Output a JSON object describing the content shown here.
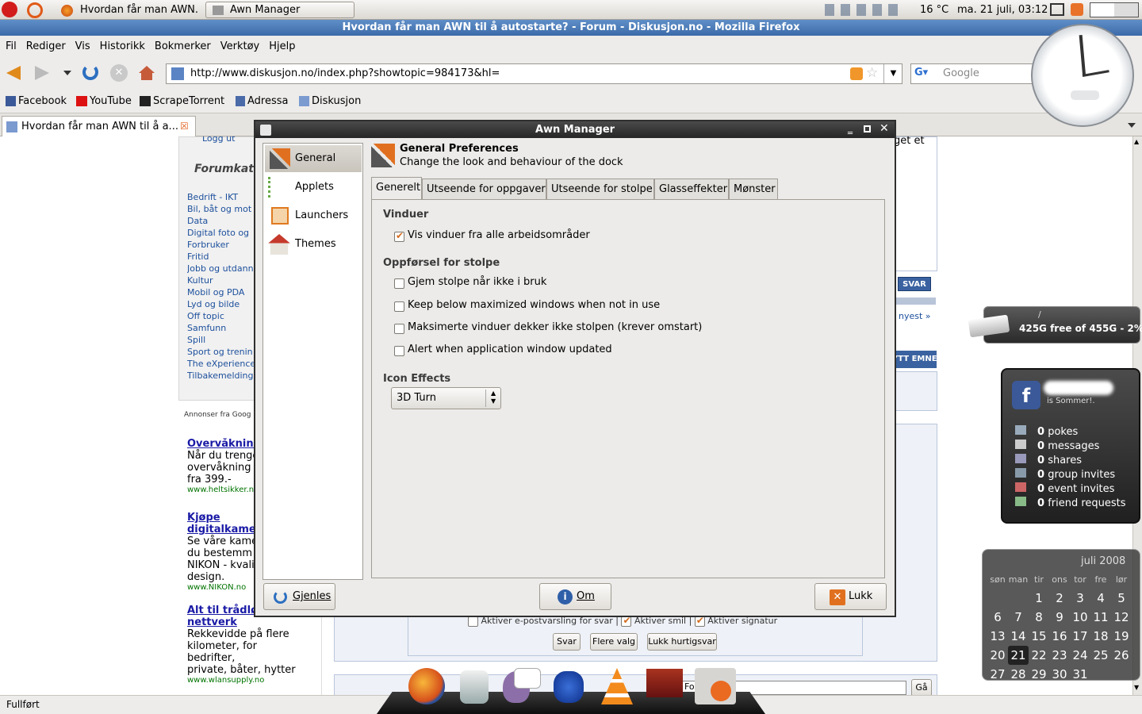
{
  "panel": {
    "tasks": [
      "Hvordan får man AWN...",
      "Awn Manager"
    ],
    "temp": "16 °C",
    "datetime": "ma. 21 juli, 03:12"
  },
  "firefox": {
    "title": "Hvordan får man AWN til å autostarte? - Forum - Diskusjon.no - Mozilla Firefox",
    "menu": [
      "Fil",
      "Rediger",
      "Vis",
      "Historikk",
      "Bokmerker",
      "Verktøy",
      "Hjelp"
    ],
    "url": "http://www.diskusjon.no/index.php?showtopic=984173&hl=",
    "search_placeholder": "Google",
    "bookmarks": [
      "Facebook",
      "YouTube",
      "ScrapeTorrent",
      "Adressa",
      "Diskusjon"
    ],
    "tab_label": "Hvordan får man AWN til å a...",
    "status": "Fullført"
  },
  "webpage": {
    "logout": "Logg ut",
    "forum_heading": "Forumkat",
    "categories": [
      "Bedrift - IKT",
      "Bil, båt og mot",
      "Data",
      "Digital foto og",
      "Forbruker",
      "Fritid",
      "Jobb og utdann",
      "Kultur",
      "Mobil og PDA",
      "Lyd og bilde",
      "Off topic",
      "Samfunn",
      "Spill",
      "Sport og trenin",
      "The eXperience",
      "Tilbakemelding"
    ],
    "ads_label": "Annonser fra Goog",
    "ads": [
      {
        "title": "Overvåkning",
        "lines": [
          "Når du trenge",
          "overvåkning",
          "fra 399.-"
        ],
        "url": "www.heltsikker.no"
      },
      {
        "title": "Kjøpe digitalkame",
        "lines": [
          "Se våre kame",
          "du bestemm",
          "NIKON - kvalit",
          "design."
        ],
        "url": "www.NIKON.no"
      },
      {
        "title": "Alt til trådløst nettverk",
        "lines": [
          "Rekkevidde på flere",
          "kilometer, for bedrifter,",
          "private, båter, hytter"
        ],
        "url": "www.wlansupply.no"
      }
    ],
    "right_snippet": "get et",
    "svar_btn": "SVAR",
    "nyest_link": "nyest »",
    "nytt_emne": "YTT EMNE",
    "options": [
      "Aktiver e-postvarsling for svar",
      "Aktiver smil",
      "Aktiver signatur"
    ],
    "buttons": [
      "Svar",
      "Flere valg",
      "Lukk hurtigsvar"
    ],
    "forum_select": "Foru",
    "go_btn": "Gå"
  },
  "dialog": {
    "title": "Awn Manager",
    "sidebar": [
      "General",
      "Applets",
      "Launchers",
      "Themes"
    ],
    "header_title": "General Preferences",
    "header_sub": "Change the look and behaviour of the dock",
    "tabs": [
      "Generelt",
      "Utseende for oppgaver",
      "Utseende for stolpe",
      "Glasseffekter",
      "Mønster"
    ],
    "section1": "Vinduer",
    "opt1": "Vis vinduer fra alle arbeidsområder",
    "section2": "Oppførsel for stolpe",
    "opt2": "Gjem stolpe når ikke i bruk",
    "opt3": "Keep below maximized windows when not in use",
    "opt4": "Maksimerte vinduer dekker ikke stolpen (krever omstart)",
    "opt5": "Alert when application window updated",
    "section3": "Icon Effects",
    "icon_effect": "3D Turn",
    "btn_reset": "Gjenles",
    "btn_about": "Om",
    "btn_close": "Lukk"
  },
  "disk": {
    "mount": "/",
    "text": "425G free of 455G - 2%"
  },
  "facebook": {
    "status": "is Sommer!.",
    "counts": [
      "0",
      "0",
      "0",
      "0",
      "0",
      "0"
    ],
    "labels": [
      "pokes",
      "messages",
      "shares",
      "group invites",
      "event invites",
      "friend requests"
    ]
  },
  "calendar": {
    "month": "juli 2008",
    "days": [
      "søn",
      "man",
      "tir",
      "ons",
      "tor",
      "fre",
      "lør"
    ],
    "weeks": [
      [
        "",
        "",
        "1",
        "2",
        "3",
        "4",
        "5"
      ],
      [
        "6",
        "7",
        "8",
        "9",
        "10",
        "11",
        "12"
      ],
      [
        "13",
        "14",
        "15",
        "16",
        "17",
        "18",
        "19"
      ],
      [
        "20",
        "21",
        "22",
        "23",
        "24",
        "25",
        "26"
      ],
      [
        "27",
        "28",
        "29",
        "30",
        "31",
        "",
        ""
      ]
    ],
    "today": "21"
  }
}
